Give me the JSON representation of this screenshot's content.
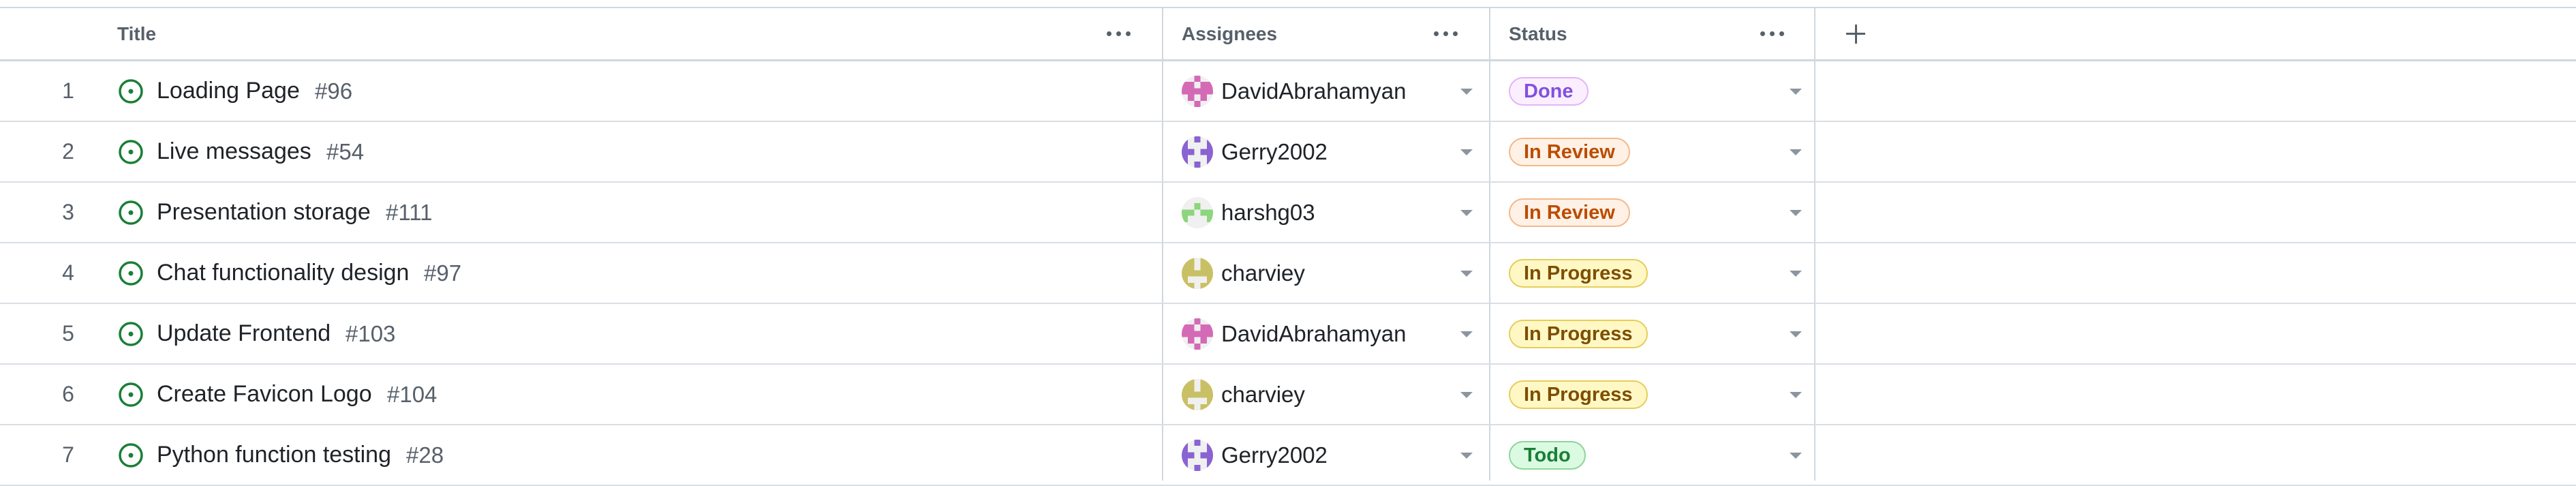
{
  "columns": {
    "title": "Title",
    "assignees": "Assignees",
    "status": "Status"
  },
  "icons": {
    "column_menu": "kebab-menu-icon",
    "add_column": "plus-icon",
    "issue_state": "issue-open-icon",
    "dropdown": "chevron-down-icon"
  },
  "colors": {
    "issue_open": "#1a7f37",
    "status": {
      "Done": {
        "bg": "#fbefff",
        "border": "#e2b5f6",
        "fg": "#8250df"
      },
      "In Review": {
        "bg": "#fff1e5",
        "border": "#f3b98b",
        "fg": "#bc4c00"
      },
      "In Progress": {
        "bg": "#fff8c5",
        "border": "#e6cd59",
        "fg": "#7d4e00"
      },
      "Todo": {
        "bg": "#dafbe1",
        "border": "#8fd49b",
        "fg": "#1a7f37"
      }
    },
    "avatars": {
      "DavidAbrahamyan": "#d46ab6",
      "Gerry2002": "#8a63d2",
      "harshg03": "#8cd67c",
      "charviey": "#c9c065"
    }
  },
  "rows": [
    {
      "num": "1",
      "title": "Loading Page",
      "issue": "#96",
      "assignee": "DavidAbrahamyan",
      "status": "Done"
    },
    {
      "num": "2",
      "title": "Live messages",
      "issue": "#54",
      "assignee": "Gerry2002",
      "status": "In Review"
    },
    {
      "num": "3",
      "title": "Presentation storage",
      "issue": "#111",
      "assignee": "harshg03",
      "status": "In Review"
    },
    {
      "num": "4",
      "title": "Chat functionality design",
      "issue": "#97",
      "assignee": "charviey",
      "status": "In Progress"
    },
    {
      "num": "5",
      "title": "Update Frontend",
      "issue": "#103",
      "assignee": "DavidAbrahamyan",
      "status": "In Progress"
    },
    {
      "num": "6",
      "title": "Create Favicon Logo",
      "issue": "#104",
      "assignee": "charviey",
      "status": "In Progress"
    },
    {
      "num": "7",
      "title": "Python function testing",
      "issue": "#28",
      "assignee": "Gerry2002",
      "status": "Todo"
    }
  ]
}
